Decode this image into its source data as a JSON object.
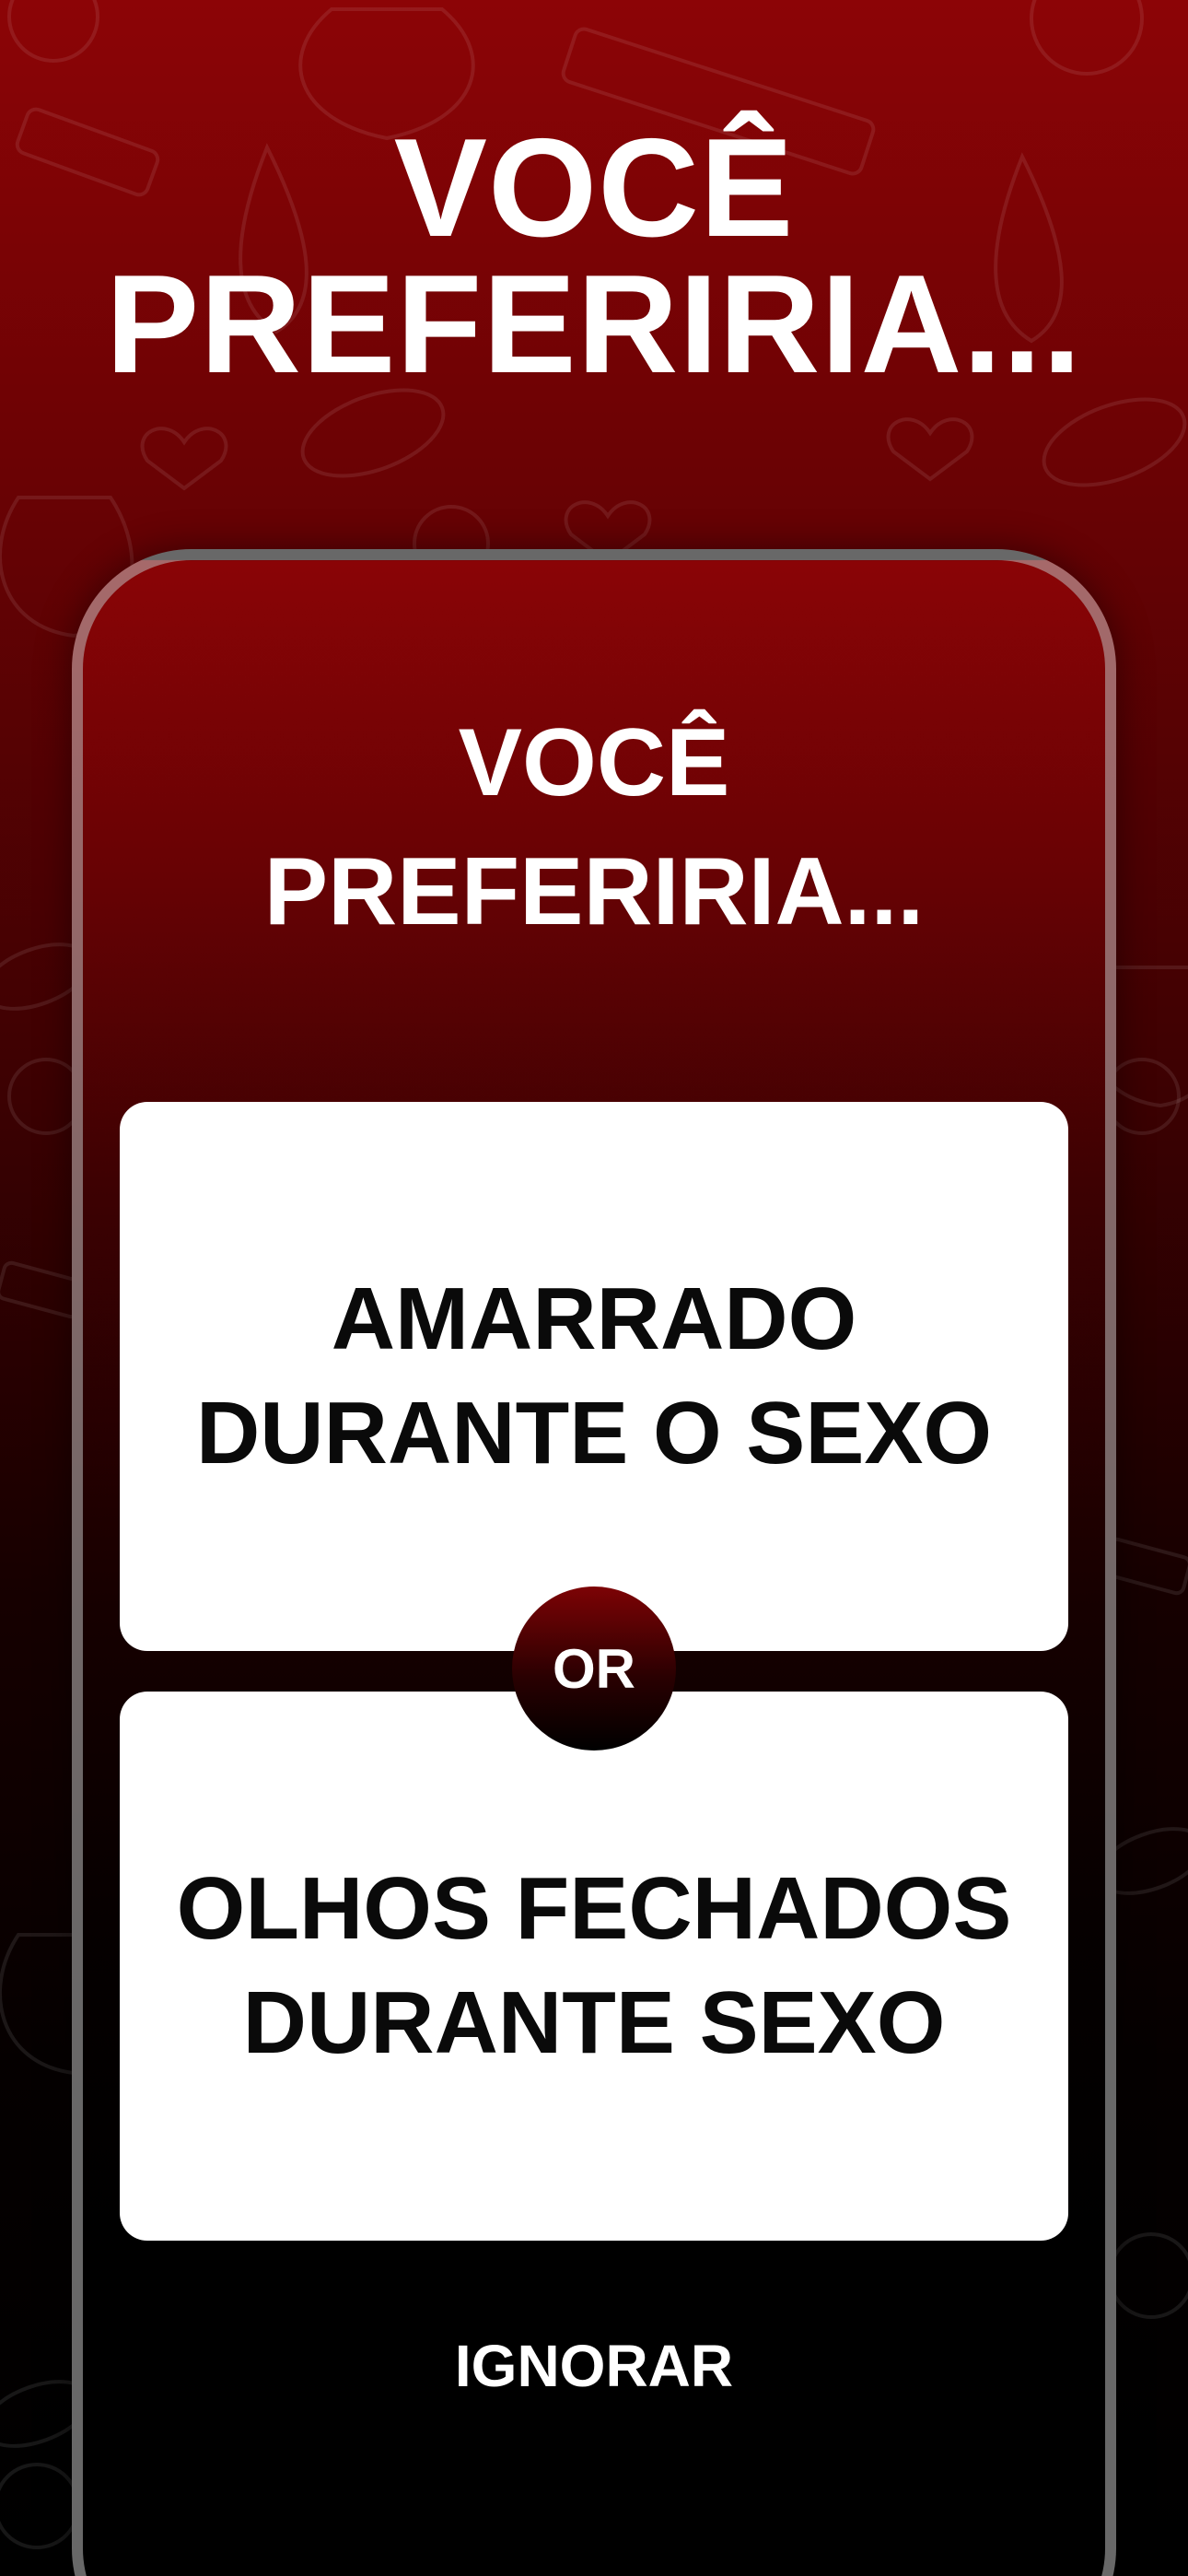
{
  "header": {
    "title_line1": "VOCÊ",
    "title_line2": "PREFERIRIA..."
  },
  "card": {
    "title_line1": "VOCÊ",
    "title_line2": "PREFERIRIA...",
    "option_a": {
      "line1": "AMARRADO",
      "line2": "DURANTE O SEXO"
    },
    "separator_label": "OR",
    "option_b": {
      "line1": "OLHOS FECHADOS",
      "line2": "DURANTE SEXO"
    },
    "skip_label": "IGNORAR"
  },
  "colors": {
    "accent_red": "#8c0406",
    "dark": "#000000",
    "card_white": "#ffffff",
    "frame_gray": "#bebebe"
  }
}
